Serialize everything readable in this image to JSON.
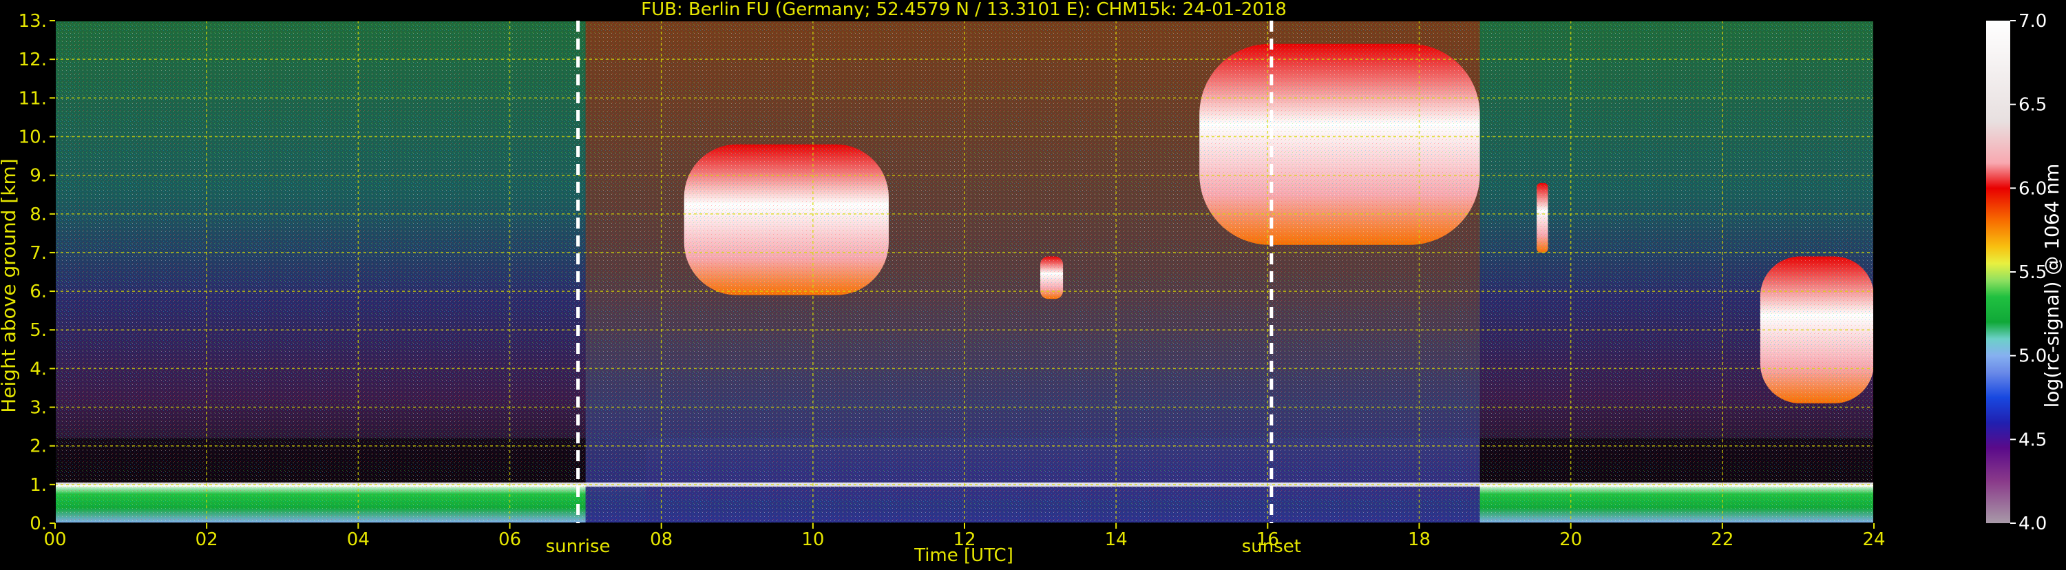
{
  "chart_data": {
    "type": "heatmap",
    "title": "FUB: Berlin FU (Germany; 52.4579 N / 13.3101 E):    CHM15k: 24-01-2018",
    "xlabel": "Time [UTC]",
    "ylabel": "Height above ground [km]",
    "xlim": [
      0,
      24
    ],
    "ylim": [
      0,
      13
    ],
    "x_ticks": [
      "00",
      "02",
      "04",
      "06",
      "08",
      "10",
      "12",
      "14",
      "16",
      "18",
      "20",
      "22",
      "24"
    ],
    "y_ticks": [
      "0.",
      "1.",
      "2.",
      "3.",
      "4.",
      "5.",
      "6.",
      "7.",
      "8.",
      "9.",
      "10.",
      "11.",
      "12.",
      "13."
    ],
    "grid": true,
    "grid_color": "#d8d800",
    "text_color": "#e6e600",
    "markers": [
      {
        "label": "sunrise",
        "time": 6.9
      },
      {
        "label": "sunset",
        "time": 16.05
      }
    ],
    "colorbar": {
      "label": "log(rc-signal) @ 1064 nm",
      "range": [
        4.0,
        7.0
      ],
      "ticks": [
        "4.0",
        "4.5",
        "5.0",
        "5.5",
        "6.0",
        "6.5",
        "7.0"
      ],
      "stops": [
        {
          "v": 4.0,
          "c": "#a89aa8"
        },
        {
          "v": 4.25,
          "c": "#8a3a8a"
        },
        {
          "v": 4.45,
          "c": "#5a0a8a"
        },
        {
          "v": 4.6,
          "c": "#2020b0"
        },
        {
          "v": 4.75,
          "c": "#1848e0"
        },
        {
          "v": 4.9,
          "c": "#6a8ae8"
        },
        {
          "v": 5.0,
          "c": "#86b0f0"
        },
        {
          "v": 5.1,
          "c": "#6cd0c8"
        },
        {
          "v": 5.2,
          "c": "#10a838"
        },
        {
          "v": 5.35,
          "c": "#20c040"
        },
        {
          "v": 5.45,
          "c": "#90e060"
        },
        {
          "v": 5.55,
          "c": "#e8f040"
        },
        {
          "v": 5.65,
          "c": "#f8c010"
        },
        {
          "v": 5.8,
          "c": "#f87000"
        },
        {
          "v": 6.0,
          "c": "#e80000"
        },
        {
          "v": 6.15,
          "c": "#f8a8b0"
        },
        {
          "v": 6.4,
          "c": "#e8e0e0"
        },
        {
          "v": 7.0,
          "c": "#ffffff"
        }
      ]
    },
    "features": [
      {
        "name": "boundary-layer-aerosol",
        "t": [
          0,
          24
        ],
        "h": [
          0,
          1.0
        ],
        "level": 5.3
      },
      {
        "name": "residual-layer",
        "t": [
          7.8,
          18.8
        ],
        "h": [
          0.6,
          2.2
        ],
        "level": 4.8
      },
      {
        "name": "day-background",
        "t": [
          7.0,
          18.8
        ],
        "h": [
          0,
          13
        ],
        "level": 5.9
      },
      {
        "name": "cirrus-morning",
        "t": [
          8.3,
          11.0
        ],
        "h": [
          5.9,
          9.8
        ],
        "level": 6.6
      },
      {
        "name": "cirrus-small",
        "t": [
          13.0,
          13.3
        ],
        "h": [
          5.8,
          6.9
        ],
        "level": 6.4
      },
      {
        "name": "cirrus-evening",
        "t": [
          15.1,
          18.8
        ],
        "h": [
          7.2,
          12.4
        ],
        "level": 6.7
      },
      {
        "name": "cloud-streak-night",
        "t": [
          19.55,
          19.7
        ],
        "h": [
          7.0,
          8.8
        ],
        "level": 6.3
      },
      {
        "name": "mid-cloud-late",
        "t": [
          22.5,
          24.0
        ],
        "h": [
          3.1,
          6.9
        ],
        "level": 6.6
      }
    ]
  }
}
